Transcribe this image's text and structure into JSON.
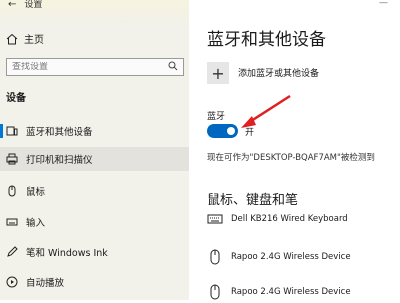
{
  "titlebar": {
    "title": "设置"
  },
  "sidebar": {
    "home_label": "主页",
    "search_placeholder": "查找设置",
    "section_title": "设备",
    "items": [
      {
        "label": "蓝牙和其他设备",
        "icon": "bluetooth-device-icon"
      },
      {
        "label": "打印机和扫描仪",
        "icon": "printer-icon"
      },
      {
        "label": "鼠标",
        "icon": "mouse-icon"
      },
      {
        "label": "输入",
        "icon": "keyboard-input-icon"
      },
      {
        "label": "笔和 Windows Ink",
        "icon": "pen-icon"
      },
      {
        "label": "自动播放",
        "icon": "autoplay-icon"
      }
    ]
  },
  "main": {
    "title": "蓝牙和其他设备",
    "add_label": "添加蓝牙或其他设备",
    "bluetooth_label": "蓝牙",
    "toggle_state": "开",
    "discoverable_text": "现在可作为\"DESKTOP-BQAF7AM\"被检测到",
    "section2_title": "鼠标、键盘和笔",
    "devices": [
      {
        "name": "Dell KB216 Wired Keyboard",
        "icon": "keyboard-icon"
      },
      {
        "name": "Rapoo 2.4G Wireless Device",
        "icon": "mouse-icon"
      },
      {
        "name": "Rapoo 2.4G Wireless Device",
        "icon": "mouse-icon"
      }
    ]
  },
  "colors": {
    "accent": "#0067c0",
    "arrow": "#e02020",
    "sidebar_bg": "#f2f1ea"
  }
}
